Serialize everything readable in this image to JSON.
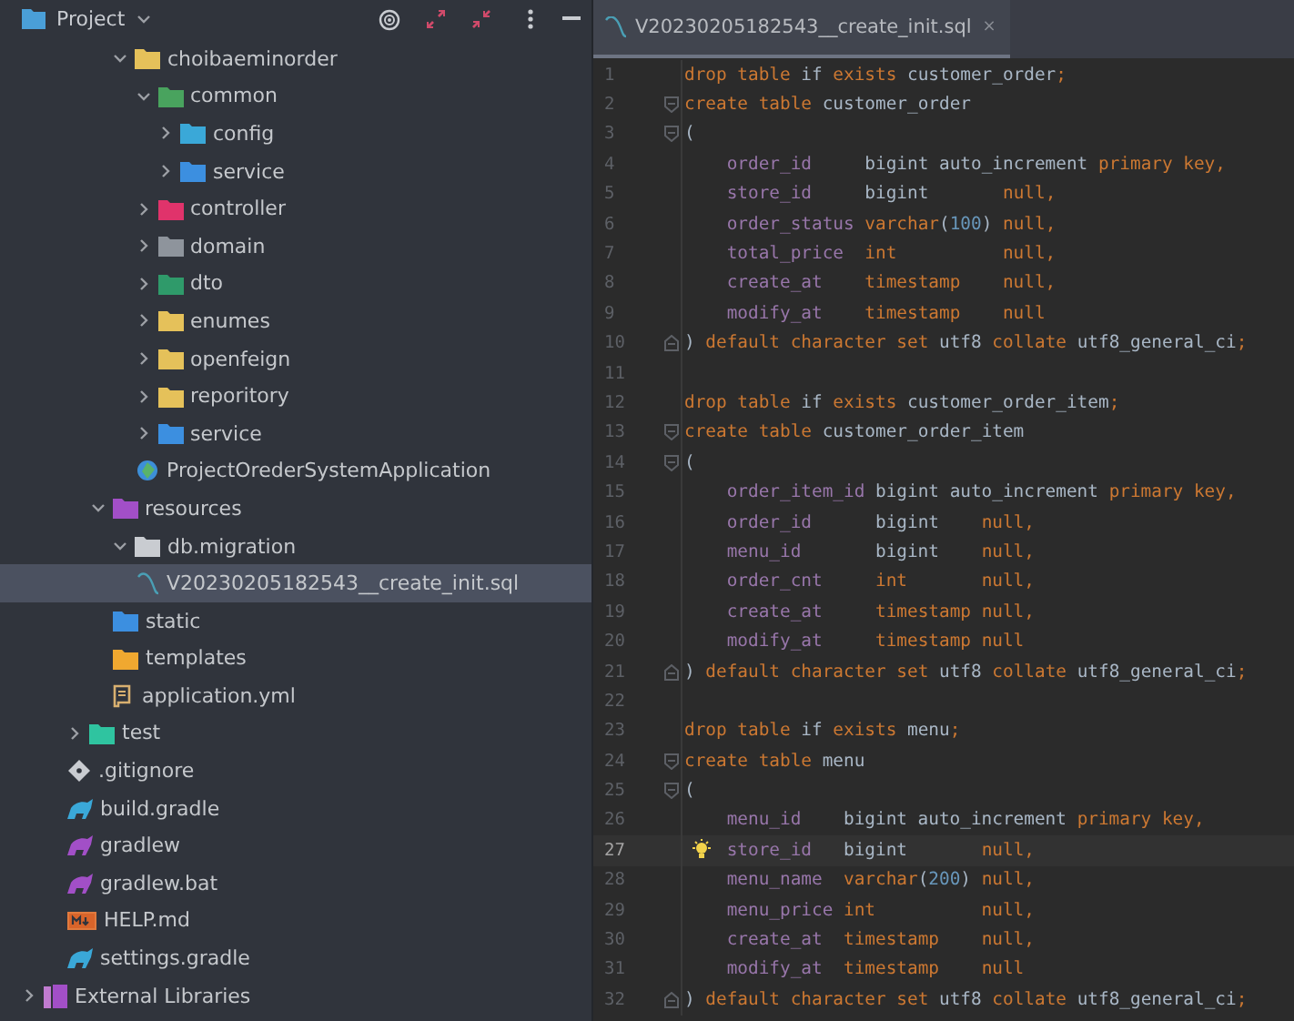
{
  "tool_window": {
    "title": "Project"
  },
  "tree": [
    {
      "children": [
        {
          "children": [
            {
              "children": [
                {
                  "children": [
                    {
                      "label": "choibaeminorder",
                      "expanded": true,
                      "kind": "folder",
                      "color": "#e5c15a",
                      "children": [
                        {
                          "label": "common",
                          "expanded": true,
                          "kind": "folder",
                          "color": "#49a35e",
                          "children": [
                            {
                              "label": "config",
                              "expanded": false,
                              "kind": "folder",
                              "color": "#3aa8d8"
                            },
                            {
                              "label": "service",
                              "expanded": false,
                              "kind": "folder",
                              "color": "#3c8fe0"
                            }
                          ]
                        },
                        {
                          "label": "controller",
                          "expanded": false,
                          "kind": "folder",
                          "color": "#e0336b"
                        },
                        {
                          "label": "domain",
                          "expanded": false,
                          "kind": "folder",
                          "color": "#8e949c"
                        },
                        {
                          "label": "dto",
                          "expanded": false,
                          "kind": "folder",
                          "color": "#2f9a6a"
                        },
                        {
                          "label": "enumes",
                          "expanded": false,
                          "kind": "folder",
                          "color": "#e5c15a"
                        },
                        {
                          "label": "openfeign",
                          "expanded": false,
                          "kind": "folder",
                          "color": "#e5c15a"
                        },
                        {
                          "label": "reporitory",
                          "expanded": false,
                          "kind": "folder",
                          "color": "#e5c15a"
                        },
                        {
                          "label": "service",
                          "expanded": false,
                          "kind": "folder",
                          "color": "#3c8fe0"
                        },
                        {
                          "label": "ProjectOrederSystemApplication",
                          "kind": "app"
                        }
                      ]
                    }
                  ]
                },
                {
                  "label": "resources",
                  "expanded": true,
                  "kind": "folder",
                  "color": "#a24fc7",
                  "children": [
                    {
                      "label": "db.migration",
                      "expanded": true,
                      "kind": "folder",
                      "color": "#c9ccd1",
                      "children": [
                        {
                          "label": "V20230205182543__create_init.sql",
                          "kind": "sql",
                          "selected": true
                        }
                      ]
                    },
                    {
                      "label": "static",
                      "kind": "folder",
                      "color": "#3c8fe0"
                    },
                    {
                      "label": "templates",
                      "kind": "folder",
                      "color": "#f0a830"
                    },
                    {
                      "label": "application.yml",
                      "kind": "yml"
                    }
                  ]
                }
              ]
            },
            {
              "label": "test",
              "expanded": false,
              "kind": "folder",
              "color": "#2fc4a0"
            },
            {
              "label": ".gitignore",
              "kind": "git"
            },
            {
              "label": "build.gradle",
              "kind": "gradle",
              "color": "#3aa8d8"
            },
            {
              "label": "gradlew",
              "kind": "gradle",
              "color": "#a24fc7"
            },
            {
              "label": "gradlew.bat",
              "kind": "gradle",
              "color": "#a24fc7"
            },
            {
              "label": "HELP.md",
              "kind": "md"
            },
            {
              "label": "settings.gradle",
              "kind": "gradle",
              "color": "#3aa8d8"
            }
          ]
        }
      ]
    },
    {
      "label": "External Libraries",
      "expanded": false,
      "kind": "libs"
    }
  ],
  "editor": {
    "tab": {
      "title": "V20230205182543__create_init.sql",
      "close": "×",
      "selected": true
    },
    "lines": [
      {
        "n": "1",
        "kind": "plain",
        "current": false,
        "tokens": [
          {
            "kind": "kw",
            "t": "drop table "
          },
          {
            "kind": "id",
            "t": "if "
          },
          {
            "kind": "kw",
            "t": "exists "
          },
          {
            "kind": "id",
            "t": "customer_order"
          },
          {
            "kind": "kw",
            "t": ";"
          }
        ]
      },
      {
        "n": "2",
        "kind": "open",
        "current": false,
        "tokens": [
          {
            "kind": "kw",
            "t": "create table "
          },
          {
            "kind": "id",
            "t": "customer_order"
          }
        ]
      },
      {
        "n": "3",
        "kind": "open",
        "current": false,
        "tokens": [
          {
            "kind": "id",
            "t": "("
          }
        ]
      },
      {
        "n": "4",
        "kind": "body",
        "current": false,
        "tokens": [
          {
            "kind": "col",
            "t": "order_id"
          },
          {
            "kind": "id",
            "t": "     bigint auto_increment "
          },
          {
            "kind": "kw",
            "t": "primary key,"
          }
        ]
      },
      {
        "n": "5",
        "kind": "body",
        "current": false,
        "tokens": [
          {
            "kind": "col",
            "t": "store_id"
          },
          {
            "kind": "id",
            "t": "     bigint       "
          },
          {
            "kind": "kw",
            "t": "null,"
          }
        ]
      },
      {
        "n": "6",
        "kind": "body",
        "current": false,
        "tokens": [
          {
            "kind": "col",
            "t": "order_status"
          },
          {
            "kind": "kw",
            "t": " varchar"
          },
          {
            "kind": "id",
            "t": "("
          },
          {
            "kind": "num",
            "t": "100"
          },
          {
            "kind": "id",
            "t": ") "
          },
          {
            "kind": "kw",
            "t": "null,"
          }
        ]
      },
      {
        "n": "7",
        "kind": "body",
        "current": false,
        "tokens": [
          {
            "kind": "col",
            "t": "total_price"
          },
          {
            "kind": "kw",
            "t": "  int          null,"
          }
        ]
      },
      {
        "n": "8",
        "kind": "body",
        "current": false,
        "tokens": [
          {
            "kind": "col",
            "t": "create_at"
          },
          {
            "kind": "kw",
            "t": "    timestamp    null,"
          }
        ]
      },
      {
        "n": "9",
        "kind": "body",
        "current": false,
        "tokens": [
          {
            "kind": "col",
            "t": "modify_at"
          },
          {
            "kind": "kw",
            "t": "    timestamp    null"
          }
        ]
      },
      {
        "n": "10",
        "kind": "close",
        "current": false,
        "tokens": [
          {
            "kind": "id",
            "t": ") "
          },
          {
            "kind": "kw",
            "t": "default character set "
          },
          {
            "kind": "id",
            "t": "utf8 "
          },
          {
            "kind": "kw",
            "t": "collate "
          },
          {
            "kind": "id",
            "t": "utf8_general_ci"
          },
          {
            "kind": "kw",
            "t": ";"
          }
        ]
      },
      {
        "n": "11",
        "kind": "plain",
        "current": false
      },
      {
        "n": "12",
        "kind": "plain",
        "current": false,
        "tokens": [
          {
            "kind": "kw",
            "t": "drop table "
          },
          {
            "kind": "id",
            "t": "if "
          },
          {
            "kind": "kw",
            "t": "exists "
          },
          {
            "kind": "id",
            "t": "customer_order_item"
          },
          {
            "kind": "kw",
            "t": ";"
          }
        ]
      },
      {
        "n": "13",
        "kind": "open",
        "current": false,
        "tokens": [
          {
            "kind": "kw",
            "t": "create table "
          },
          {
            "kind": "id",
            "t": "customer_order_item"
          }
        ]
      },
      {
        "n": "14",
        "kind": "open",
        "current": false,
        "tokens": [
          {
            "kind": "id",
            "t": "("
          }
        ]
      },
      {
        "n": "15",
        "kind": "body",
        "current": false,
        "tokens": [
          {
            "kind": "col",
            "t": "order_item_id"
          },
          {
            "kind": "id",
            "t": " bigint auto_increment "
          },
          {
            "kind": "kw",
            "t": "primary key,"
          }
        ]
      },
      {
        "n": "16",
        "kind": "body",
        "current": false,
        "tokens": [
          {
            "kind": "col",
            "t": "order_id"
          },
          {
            "kind": "id",
            "t": "      bigint    "
          },
          {
            "kind": "kw",
            "t": "null,"
          }
        ]
      },
      {
        "n": "17",
        "kind": "body",
        "current": false,
        "tokens": [
          {
            "kind": "col",
            "t": "menu_id"
          },
          {
            "kind": "id",
            "t": "       bigint    "
          },
          {
            "kind": "kw",
            "t": "null,"
          }
        ]
      },
      {
        "n": "18",
        "kind": "body",
        "current": false,
        "tokens": [
          {
            "kind": "col",
            "t": "order_cnt"
          },
          {
            "kind": "kw",
            "t": "     int       null,"
          }
        ]
      },
      {
        "n": "19",
        "kind": "body",
        "current": false,
        "tokens": [
          {
            "kind": "col",
            "t": "create_at"
          },
          {
            "kind": "kw",
            "t": "     timestamp null,"
          }
        ]
      },
      {
        "n": "20",
        "kind": "body",
        "current": false,
        "tokens": [
          {
            "kind": "col",
            "t": "modify_at"
          },
          {
            "kind": "kw",
            "t": "     timestamp null"
          }
        ]
      },
      {
        "n": "21",
        "kind": "close",
        "current": false,
        "tokens": [
          {
            "kind": "id",
            "t": ") "
          },
          {
            "kind": "kw",
            "t": "default character set "
          },
          {
            "kind": "id",
            "t": "utf8 "
          },
          {
            "kind": "kw",
            "t": "collate "
          },
          {
            "kind": "id",
            "t": "utf8_general_ci"
          },
          {
            "kind": "kw",
            "t": ";"
          }
        ]
      },
      {
        "n": "22",
        "kind": "plain",
        "current": false
      },
      {
        "n": "23",
        "kind": "plain",
        "current": false,
        "tokens": [
          {
            "kind": "kw",
            "t": "drop table "
          },
          {
            "kind": "id",
            "t": "if "
          },
          {
            "kind": "kw",
            "t": "exists "
          },
          {
            "kind": "id",
            "t": "menu"
          },
          {
            "kind": "kw",
            "t": ";"
          }
        ]
      },
      {
        "n": "24",
        "kind": "open",
        "current": false,
        "tokens": [
          {
            "kind": "kw",
            "t": "create table "
          },
          {
            "kind": "id",
            "t": "menu"
          }
        ]
      },
      {
        "n": "25",
        "kind": "open",
        "current": false,
        "tokens": [
          {
            "kind": "id",
            "t": "("
          }
        ]
      },
      {
        "n": "26",
        "kind": "body",
        "current": false,
        "tokens": [
          {
            "kind": "col",
            "t": "menu_id"
          },
          {
            "kind": "id",
            "t": "    bigint auto_increment "
          },
          {
            "kind": "kw",
            "t": "primary key,"
          }
        ]
      },
      {
        "n": "27",
        "kind": "body",
        "current": true,
        "tokens": [
          {
            "kind": "col",
            "t": "store_id"
          },
          {
            "kind": "id",
            "t": "   bigint       "
          },
          {
            "kind": "kw",
            "t": "null,"
          }
        ]
      },
      {
        "n": "28",
        "kind": "body",
        "current": false,
        "tokens": [
          {
            "kind": "col",
            "t": "menu_name"
          },
          {
            "kind": "kw",
            "t": "  varchar"
          },
          {
            "kind": "id",
            "t": "("
          },
          {
            "kind": "num",
            "t": "200"
          },
          {
            "kind": "id",
            "t": ") "
          },
          {
            "kind": "kw",
            "t": "null,"
          }
        ]
      },
      {
        "n": "29",
        "kind": "body",
        "current": false,
        "tokens": [
          {
            "kind": "col",
            "t": "menu_price"
          },
          {
            "kind": "kw",
            "t": " int          null,"
          }
        ]
      },
      {
        "n": "30",
        "kind": "body",
        "current": false,
        "tokens": [
          {
            "kind": "col",
            "t": "create_at"
          },
          {
            "kind": "kw",
            "t": "  timestamp    null,"
          }
        ]
      },
      {
        "n": "31",
        "kind": "body",
        "current": false,
        "tokens": [
          {
            "kind": "col",
            "t": "modify_at"
          },
          {
            "kind": "kw",
            "t": "  timestamp    null"
          }
        ]
      },
      {
        "n": "32",
        "kind": "close",
        "current": false,
        "tokens": [
          {
            "kind": "id",
            "t": ") "
          },
          {
            "kind": "kw",
            "t": "default character set "
          },
          {
            "kind": "id",
            "t": "utf8 "
          },
          {
            "kind": "kw",
            "t": "collate "
          },
          {
            "kind": "id",
            "t": "utf8_general_ci"
          },
          {
            "kind": "kw",
            "t": ";"
          }
        ]
      }
    ]
  }
}
